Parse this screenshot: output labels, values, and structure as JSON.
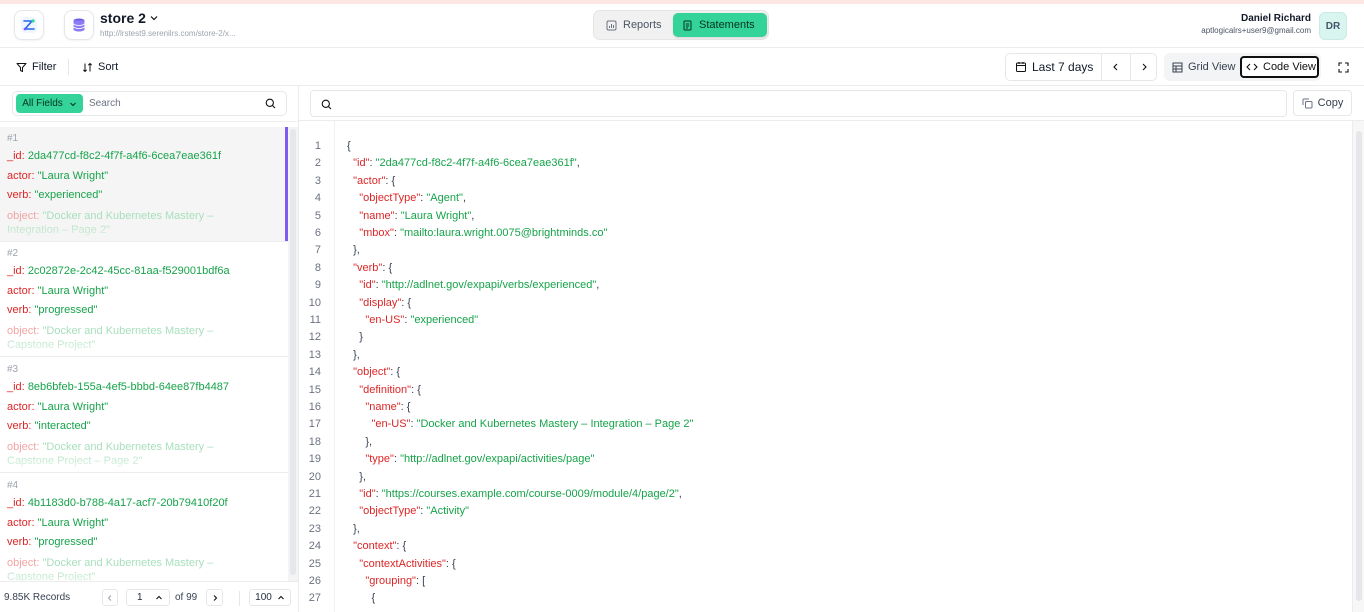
{
  "header": {
    "store_name": "store 2",
    "store_url": "http://lrstest9.serenilrs.com/store-2/x...",
    "tabs": [
      {
        "label": "Reports",
        "active": false
      },
      {
        "label": "Statements",
        "active": true
      }
    ],
    "user_name": "Daniel Richard",
    "user_email": "aptlogicalrs+user9@gmail.com",
    "avatar_initials": "DR"
  },
  "toolbar": {
    "filter_label": "Filter",
    "sort_label": "Sort",
    "date_range": "Last 7 days",
    "grid_view_label": "Grid View",
    "code_view_label": "Code View"
  },
  "left_panel": {
    "field_selector": "All Fields",
    "search_placeholder": "Search",
    "records": [
      {
        "num": "#1",
        "id_key": "_id:",
        "id": "2da477cd-f8c2-4f7f-a4f6-6cea7eae361f",
        "actor_key": "actor:",
        "actor": "\"Laura Wright\"",
        "verb_key": "verb:",
        "verb": "\"experienced\"",
        "object_key": "object:",
        "object": "\"Docker and Kubernetes Mastery – Integration – Page 2\""
      },
      {
        "num": "#2",
        "id_key": "_id:",
        "id": "2c02872e-2c42-45cc-81aa-f529001bdf6a",
        "actor_key": "actor:",
        "actor": "\"Laura Wright\"",
        "verb_key": "verb:",
        "verb": "\"progressed\"",
        "object_key": "object:",
        "object": "\"Docker and Kubernetes Mastery – Capstone Project\""
      },
      {
        "num": "#3",
        "id_key": "_id:",
        "id": "8eb6bfeb-155a-4ef5-bbbd-64ee87fb4487",
        "actor_key": "actor:",
        "actor": "\"Laura Wright\"",
        "verb_key": "verb:",
        "verb": "\"interacted\"",
        "object_key": "object:",
        "object": "\"Docker and Kubernetes Mastery – Capstone Project – Page 2\""
      },
      {
        "num": "#4",
        "id_key": "_id:",
        "id": "4b1183d0-b788-4a17-acf7-20b79410f20f",
        "actor_key": "actor:",
        "actor": "\"Laura Wright\"",
        "verb_key": "verb:",
        "verb": "\"progressed\"",
        "object_key": "object:",
        "object": "\"Docker and Kubernetes Mastery – Capstone Project\""
      }
    ],
    "records_count": "9.85K Records",
    "current_page": "1",
    "total_pages": "of 99",
    "page_size": "100"
  },
  "right_panel": {
    "search_value": "",
    "copy_label": "Copy",
    "code_lines": [
      {
        "n": "1",
        "t": "{"
      },
      {
        "n": "2",
        "t": "  \"id\": \"2da477cd-f8c2-4f7f-a4f6-6cea7eae361f\","
      },
      {
        "n": "3",
        "t": "  \"actor\": {"
      },
      {
        "n": "4",
        "t": "    \"objectType\": \"Agent\","
      },
      {
        "n": "5",
        "t": "    \"name\": \"Laura Wright\","
      },
      {
        "n": "6",
        "t": "    \"mbox\": \"mailto:laura.wright.0075@brightminds.co\""
      },
      {
        "n": "7",
        "t": "  },"
      },
      {
        "n": "8",
        "t": "  \"verb\": {"
      },
      {
        "n": "9",
        "t": "    \"id\": \"http://adlnet.gov/expapi/verbs/experienced\","
      },
      {
        "n": "10",
        "t": "    \"display\": {"
      },
      {
        "n": "11",
        "t": "      \"en-US\": \"experienced\""
      },
      {
        "n": "12",
        "t": "    }"
      },
      {
        "n": "13",
        "t": "  },"
      },
      {
        "n": "14",
        "t": "  \"object\": {"
      },
      {
        "n": "15",
        "t": "    \"definition\": {"
      },
      {
        "n": "16",
        "t": "      \"name\": {"
      },
      {
        "n": "17",
        "t": "        \"en-US\": \"Docker and Kubernetes Mastery – Integration – Page 2\""
      },
      {
        "n": "18",
        "t": "      },"
      },
      {
        "n": "19",
        "t": "      \"type\": \"http://adlnet.gov/expapi/activities/page\""
      },
      {
        "n": "20",
        "t": "    },"
      },
      {
        "n": "21",
        "t": "    \"id\": \"https://courses.example.com/course-0009/module/4/page/2\","
      },
      {
        "n": "22",
        "t": "    \"objectType\": \"Activity\""
      },
      {
        "n": "23",
        "t": "  },"
      },
      {
        "n": "24",
        "t": "  \"context\": {"
      },
      {
        "n": "25",
        "t": "    \"contextActivities\": {"
      },
      {
        "n": "26",
        "t": "      \"grouping\": ["
      },
      {
        "n": "27",
        "t": "        {"
      }
    ]
  },
  "colors": {
    "accent_green": "#34d39a",
    "selected_bar": "#7c5cf0",
    "json_key": "#dc2626",
    "json_value": "#16a34a"
  },
  "icons": [
    "app-logo-icon",
    "database-icon",
    "chevron-down-icon",
    "chart-icon",
    "document-icon",
    "filter-icon",
    "sort-icon",
    "calendar-icon",
    "chevron-left-icon",
    "chevron-right-icon",
    "grid-icon",
    "code-icon",
    "fullscreen-icon",
    "search-icon",
    "copy-icon",
    "chevron-up-icon"
  ]
}
